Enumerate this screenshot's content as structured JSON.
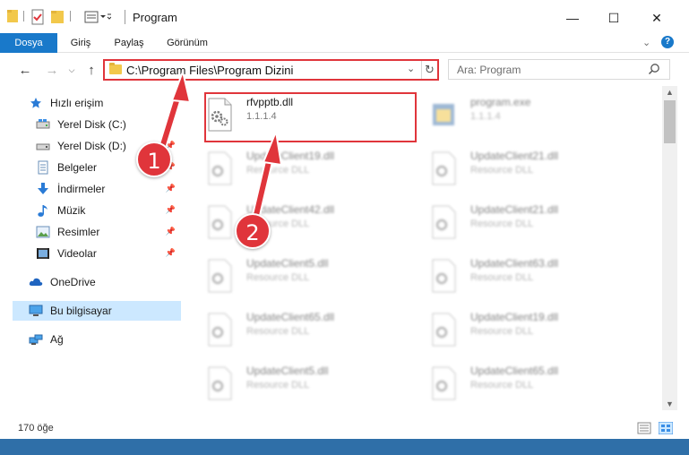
{
  "window": {
    "title": "Program",
    "minimize": "—",
    "maximize": "☐",
    "close": "✕"
  },
  "ribbon": {
    "tabs": [
      "Dosya",
      "Giriş",
      "Paylaş",
      "Görünüm"
    ],
    "help": "?"
  },
  "navbar": {
    "address_path": "C:\\Program Files\\Program Dizini",
    "search_placeholder": "Ara: Program"
  },
  "sidebar": {
    "items": [
      {
        "label": "Hızlı erişim",
        "icon": "star-icon"
      },
      {
        "label": "Yerel Disk (C:)",
        "icon": "disk-icon",
        "pinned": true
      },
      {
        "label": "Yerel Disk (D:)",
        "icon": "disk-icon",
        "pinned": true
      },
      {
        "label": "Belgeler",
        "icon": "documents-icon",
        "pinned": true
      },
      {
        "label": "İndirmeler",
        "icon": "download-icon",
        "pinned": true
      },
      {
        "label": "Müzik",
        "icon": "music-icon",
        "pinned": true
      },
      {
        "label": "Resimler",
        "icon": "pictures-icon",
        "pinned": true
      },
      {
        "label": "Videolar",
        "icon": "videos-icon",
        "pinned": true
      },
      {
        "label": "OneDrive",
        "icon": "cloud-icon"
      },
      {
        "label": "Bu bilgisayar",
        "icon": "computer-icon",
        "selected": true
      },
      {
        "label": "Ağ",
        "icon": "network-icon"
      }
    ]
  },
  "files": [
    {
      "name": "rfvpptb.dll",
      "desc": "1.1.1.4",
      "highlighted": true
    },
    {
      "name": "program.exe",
      "desc": "1.1.1.4"
    },
    {
      "name": "UpdateClient19.dll",
      "desc": "Resource DLL"
    },
    {
      "name": "UpdateClient21.dll",
      "desc": "Resource DLL"
    },
    {
      "name": "UpdateClient42.dll",
      "desc": "Resource DLL"
    },
    {
      "name": "UpdateClient21.dll",
      "desc": "Resource DLL"
    },
    {
      "name": "UpdateClient5.dll",
      "desc": "Resource DLL"
    },
    {
      "name": "UpdateClient63.dll",
      "desc": "Resource DLL"
    },
    {
      "name": "UpdateClient65.dll",
      "desc": "Resource DLL"
    },
    {
      "name": "UpdateClient19.dll",
      "desc": "Resource DLL"
    },
    {
      "name": "UpdateClient5.dll",
      "desc": "Resource DLL"
    },
    {
      "name": "UpdateClient65.dll",
      "desc": "Resource DLL"
    }
  ],
  "status": {
    "item_count": "170 öğe"
  },
  "annotations": {
    "step1": "1",
    "step2": "2"
  },
  "colors": {
    "accent": "#1979ca",
    "highlight_red": "#e0353b",
    "selected_bg": "#cce8ff"
  }
}
